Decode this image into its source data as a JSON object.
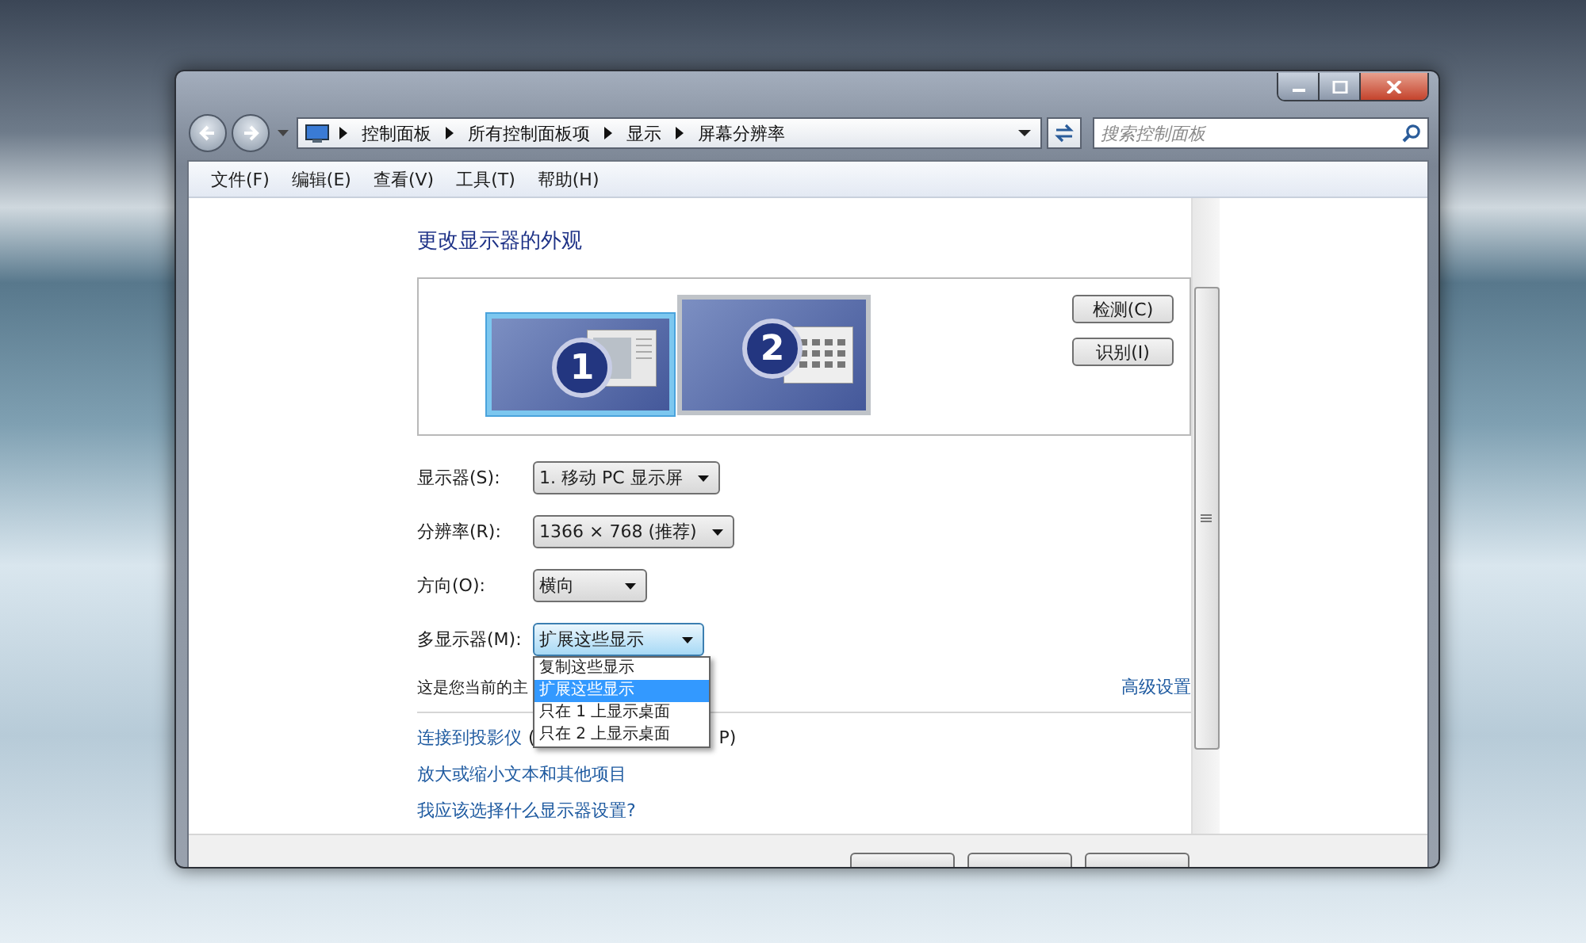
{
  "address_bar": {
    "breadcrumbs": [
      "控制面板",
      "所有控制面板项",
      "显示",
      "屏幕分辨率"
    ]
  },
  "search": {
    "placeholder": "搜索控制面板"
  },
  "menu": [
    "文件(F)",
    "编辑(E)",
    "查看(V)",
    "工具(T)",
    "帮助(H)"
  ],
  "heading": "更改显示器的外观",
  "monitors": [
    {
      "label": "1",
      "selected": true
    },
    {
      "label": "2",
      "selected": false
    }
  ],
  "preview_buttons": [
    "检测(C)",
    "识别(I)"
  ],
  "fields": [
    {
      "label": "显示器(S):",
      "value": "1. 移动 PC 显示屏",
      "expanded": false
    },
    {
      "label": "分辨率(R):",
      "value": "1366 × 768 (推荐)",
      "expanded": false
    },
    {
      "label": "方向(O):",
      "value": "横向",
      "expanded": false
    },
    {
      "label": "多显示器(M):",
      "value": "扩展这些显示",
      "expanded": true,
      "options": [
        {
          "label": "复制这些显示",
          "selected": false
        },
        {
          "label": "扩展这些显示",
          "selected": true
        },
        {
          "label": "只在 1 上显示桌面",
          "selected": false
        },
        {
          "label": "只在 2 上显示桌面",
          "selected": false
        }
      ]
    }
  ],
  "primary_note": "这是您当前的主",
  "advanced_link": "高级设置",
  "projector_row": {
    "link": "连接到投影仪",
    "text_start": "(",
    "text_end": "P)"
  },
  "links": [
    "放大或缩小文本和其他项目",
    "我应该选择什么显示器设置?"
  ]
}
